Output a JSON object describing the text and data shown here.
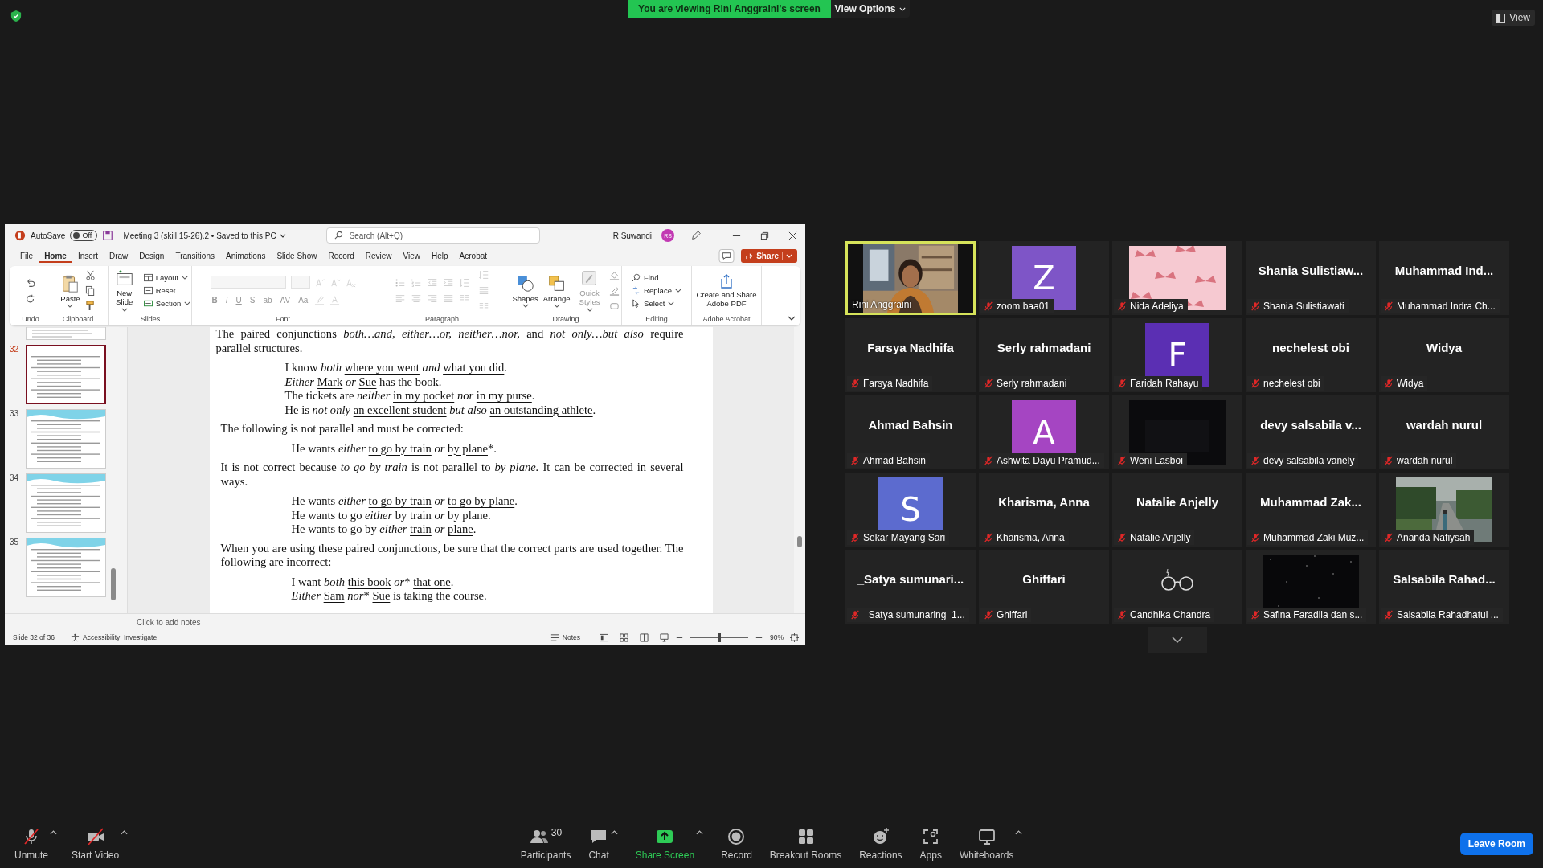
{
  "zoom": {
    "banner": "You are viewing Rini Anggraini's screen",
    "view_options": "View Options",
    "view": "View"
  },
  "powerpoint": {
    "title_bar": {
      "autosave": "AutoSave",
      "autosave_state": "Off",
      "autosave_on": false,
      "document": "Meeting 3 (skill 15-26).2 • Saved to this PC",
      "search_placeholder": "Search (Alt+Q)",
      "user": "R Suwandi",
      "initials": "RS"
    },
    "tabs": [
      {
        "label": "File",
        "selected": false
      },
      {
        "label": "Home",
        "selected": true
      },
      {
        "label": "Insert",
        "selected": false
      },
      {
        "label": "Draw",
        "selected": false
      },
      {
        "label": "Design",
        "selected": false
      },
      {
        "label": "Transitions",
        "selected": false
      },
      {
        "label": "Animations",
        "selected": false
      },
      {
        "label": "Slide Show",
        "selected": false
      },
      {
        "label": "Record",
        "selected": false
      },
      {
        "label": "Review",
        "selected": false
      },
      {
        "label": "View",
        "selected": false
      },
      {
        "label": "Help",
        "selected": false
      },
      {
        "label": "Acrobat",
        "selected": false
      }
    ],
    "share": "Share",
    "ribbon": {
      "undo": "Undo",
      "clipboard": {
        "label": "Clipboard",
        "paste": "Paste"
      },
      "slides": {
        "label": "Slides",
        "new_slide": "New Slide",
        "layout": "Layout",
        "reset": "Reset",
        "section": "Section"
      },
      "font": {
        "label": "Font",
        "disabled": true,
        "format_buttons": [
          "B",
          "I",
          "U",
          "S",
          "ab",
          "AV",
          "Aa"
        ]
      },
      "paragraph": {
        "label": "Paragraph",
        "disabled": true
      },
      "drawing": {
        "label": "Drawing",
        "shapes": "Shapes",
        "arrange": "Arrange",
        "quick_styles": "Quick Styles",
        "quick_styles_disabled": true
      },
      "editing": {
        "label": "Editing",
        "find": "Find",
        "replace": "Replace",
        "select": "Select"
      },
      "acrobat": {
        "label": "Adobe Acrobat",
        "create": "Create and Share Adobe PDF"
      }
    },
    "thumbnails": [
      {
        "number": "32",
        "selected": true
      },
      {
        "number": "33",
        "selected": false
      },
      {
        "number": "34",
        "selected": false
      },
      {
        "number": "35",
        "selected": false
      }
    ],
    "slide": [
      {
        "kind": "para",
        "text": "The paired conjunctions *both…and, either…or, neither…nor,* and *not only…but also* require parallel structures."
      },
      {
        "kind": "examples",
        "lines": [
          [
            {
              "kind": "text",
              "text": "I know *both* "
            },
            {
              "kind": "underlined",
              "text": "where you went"
            },
            {
              "kind": "text",
              "text": " *and* "
            },
            {
              "kind": "underlined",
              "text": "what you did"
            },
            {
              "kind": "text",
              "text": "."
            }
          ],
          [
            {
              "kind": "text",
              "text": "*Either* "
            },
            {
              "kind": "underlined",
              "text": "Mark"
            },
            {
              "kind": "text",
              "text": " *or* "
            },
            {
              "kind": "underlined",
              "text": "Sue"
            },
            {
              "kind": "text",
              "text": " has the book."
            }
          ],
          [
            {
              "kind": "text",
              "text": "The tickets are *neither* "
            },
            {
              "kind": "underlined",
              "text": "in my pocket"
            },
            {
              "kind": "text",
              "text": " *nor* "
            },
            {
              "kind": "underlined",
              "text": "in my purse"
            },
            {
              "kind": "text",
              "text": "."
            }
          ],
          [
            {
              "kind": "text",
              "text": "He is *not only* "
            },
            {
              "kind": "underlined",
              "text": "an excellent student"
            },
            {
              "kind": "text",
              "text": " *but also* "
            },
            {
              "kind": "underlined",
              "text": "an outstanding athlete"
            },
            {
              "kind": "text",
              "text": "."
            }
          ]
        ]
      },
      {
        "kind": "para",
        "text": "The following is not parallel and must be corrected:"
      },
      {
        "kind": "examples",
        "lines": [
          [
            {
              "kind": "text",
              "text": "He wants *either* "
            },
            {
              "kind": "underlined",
              "text": "to go by train"
            },
            {
              "kind": "text",
              "text": " *or* "
            },
            {
              "kind": "underlined",
              "text": "by plane"
            },
            {
              "kind": "text",
              "text": "*."
            }
          ]
        ]
      },
      {
        "kind": "para",
        "text": "It is not correct because *to go by train* is not parallel to *by plane.* It can be corrected in several ways."
      },
      {
        "kind": "examples",
        "lines": [
          [
            {
              "kind": "text",
              "text": "He wants *either* "
            },
            {
              "kind": "underlined",
              "text": "to go by train"
            },
            {
              "kind": "text",
              "text": " *or* "
            },
            {
              "kind": "underlined",
              "text": "to go by plane"
            },
            {
              "kind": "text",
              "text": "."
            }
          ],
          [
            {
              "kind": "text",
              "text": "He wants to go *either* "
            },
            {
              "kind": "underlined",
              "text": "by train"
            },
            {
              "kind": "text",
              "text": " *or* "
            },
            {
              "kind": "underlined",
              "text": "by plane"
            },
            {
              "kind": "text",
              "text": "."
            }
          ],
          [
            {
              "kind": "text",
              "text": "He wants to go by *either* "
            },
            {
              "kind": "underlined",
              "text": "train"
            },
            {
              "kind": "text",
              "text": " *or* "
            },
            {
              "kind": "underlined",
              "text": "plane"
            },
            {
              "kind": "text",
              "text": "."
            }
          ]
        ]
      },
      {
        "kind": "para",
        "text": "When you are using these paired conjunctions, be sure that the correct parts are used together. The following are incorrect:"
      },
      {
        "kind": "examples",
        "lines": [
          [
            {
              "kind": "text",
              "text": "I want *both* "
            },
            {
              "kind": "underlined",
              "text": "this book"
            },
            {
              "kind": "text",
              "text": " *or*"
            },
            {
              "kind": "text",
              "text": "* "
            },
            {
              "kind": "underlined",
              "text": "that one"
            },
            {
              "kind": "text",
              "text": "."
            }
          ],
          [
            {
              "kind": "text",
              "text": "*Either* "
            },
            {
              "kind": "underlined",
              "text": "Sam"
            },
            {
              "kind": "text",
              "text": " *nor*"
            },
            {
              "kind": "text",
              "text": "* "
            },
            {
              "kind": "underlined",
              "text": "Sue"
            },
            {
              "kind": "text",
              "text": " is taking the course."
            }
          ]
        ]
      }
    ],
    "notes_placeholder": "Click to add notes",
    "status": {
      "slide": "Slide 32 of 36",
      "accessibility": "Accessibility: Investigate",
      "notes": "Notes",
      "zoom": "90%",
      "level": 0.5
    }
  },
  "gallery": [
    {
      "name": "Rini Anggraini",
      "muted": false,
      "active": true,
      "kind": "picture"
    },
    {
      "name": "zoom baa01",
      "muted": true,
      "active": false,
      "kind": "avatar",
      "letter": "Z",
      "color": "#7e55c7"
    },
    {
      "name": "Nida Adeliya",
      "muted": true,
      "active": false,
      "kind": "picture"
    },
    {
      "name": "Shania Sulistiawati",
      "muted": true,
      "active": false,
      "kind": "name",
      "display_name": "Shania Sulistiaw..."
    },
    {
      "name": "Muhammad Indra Ch...",
      "muted": true,
      "active": false,
      "kind": "name",
      "display_name": "Muhammad Ind..."
    },
    {
      "name": "Farsya Nadhifa",
      "muted": true,
      "active": false,
      "kind": "name",
      "display_name": "Farsya Nadhifa"
    },
    {
      "name": "Serly rahmadani",
      "muted": true,
      "active": false,
      "kind": "name",
      "display_name": "Serly rahmadani"
    },
    {
      "name": "Faridah Rahayu",
      "muted": true,
      "active": false,
      "kind": "avatar",
      "letter": "F",
      "color": "#5b2fb3"
    },
    {
      "name": "nechelest obi",
      "muted": true,
      "active": false,
      "kind": "name",
      "display_name": "nechelest obi"
    },
    {
      "name": "Widya",
      "muted": true,
      "active": false,
      "kind": "name",
      "display_name": "Widya"
    },
    {
      "name": "Ahmad Bahsin",
      "muted": true,
      "active": false,
      "kind": "name",
      "display_name": "Ahmad Bahsin"
    },
    {
      "name": "Ashwita Dayu Pramud...",
      "muted": true,
      "active": false,
      "kind": "avatar",
      "letter": "A",
      "color": "#a545c2"
    },
    {
      "name": "Weni Lasboi",
      "muted": true,
      "active": false,
      "kind": "picture"
    },
    {
      "name": "devy salsabila vanely",
      "muted": true,
      "active": false,
      "kind": "name",
      "display_name": "devy salsabila v..."
    },
    {
      "name": "wardah nurul",
      "muted": true,
      "active": false,
      "kind": "name",
      "display_name": "wardah nurul"
    },
    {
      "name": "Sekar Mayang Sari",
      "muted": true,
      "active": false,
      "kind": "avatar",
      "letter": "S",
      "color": "#5c6bcf"
    },
    {
      "name": "Kharisma, Anna",
      "muted": true,
      "active": false,
      "kind": "name",
      "display_name": "Kharisma, Anna"
    },
    {
      "name": "Natalie Anjelly",
      "muted": true,
      "active": false,
      "kind": "name",
      "display_name": "Natalie Anjelly"
    },
    {
      "name": "Muhammad Zaki Muz...",
      "muted": true,
      "active": false,
      "kind": "name",
      "display_name": "Muhammad Zak..."
    },
    {
      "name": "Ananda Nafiysah",
      "muted": true,
      "active": false,
      "kind": "picture"
    },
    {
      "name": "_Satya sumunaring_1...",
      "muted": true,
      "active": false,
      "kind": "name",
      "display_name": "_Satya sumunari..."
    },
    {
      "name": "Ghiffari",
      "muted": true,
      "active": false,
      "kind": "name",
      "display_name": "Ghiffari"
    },
    {
      "name": "Candhika Chandra",
      "muted": true,
      "active": false,
      "kind": "icon"
    },
    {
      "name": "Safina Faradila dan s...",
      "muted": true,
      "active": false,
      "kind": "picture"
    },
    {
      "name": "Salsabila Rahadhatul ...",
      "muted": true,
      "active": false,
      "kind": "name",
      "display_name": "Salsabila Rahad..."
    }
  ],
  "toolbar": {
    "items": [
      {
        "label": "Unmute",
        "kind": "mic",
        "caret": true
      },
      {
        "label": "Start Video",
        "kind": "video",
        "caret": true
      },
      {
        "label": "Participants",
        "kind": "participants",
        "count": "30",
        "caret": false
      },
      {
        "label": "Chat",
        "kind": "chat",
        "caret": true
      },
      {
        "label": "Share Screen",
        "kind": "share",
        "caret": true
      },
      {
        "label": "Record",
        "kind": "record",
        "caret": false
      },
      {
        "label": "Breakout Rooms",
        "kind": "breakout",
        "caret": false
      },
      {
        "label": "Reactions",
        "kind": "reactions",
        "caret": false
      },
      {
        "label": "Apps",
        "kind": "apps",
        "caret": false
      },
      {
        "label": "Whiteboards",
        "kind": "whiteboard",
        "caret": true
      }
    ],
    "leave": "Leave Room"
  }
}
